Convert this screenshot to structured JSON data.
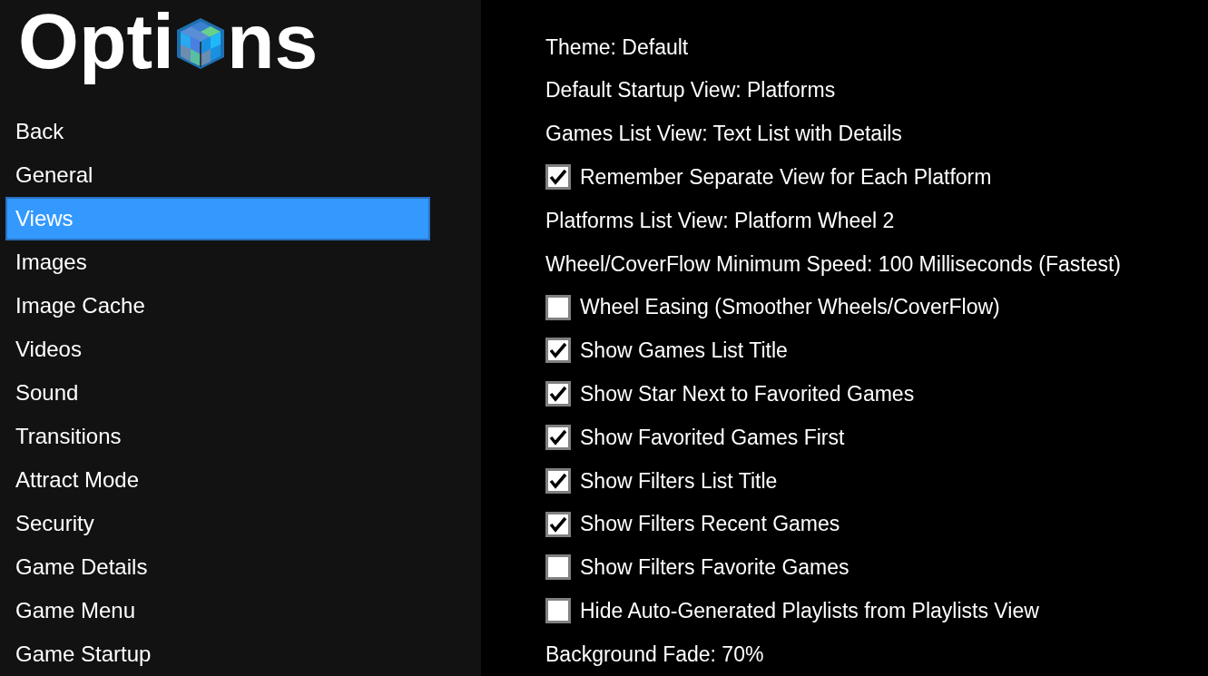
{
  "title": {
    "before": "Opti",
    "after": "ns"
  },
  "sidebar": {
    "items": [
      {
        "label": "Back",
        "selected": false
      },
      {
        "label": "General",
        "selected": false
      },
      {
        "label": "Views",
        "selected": true
      },
      {
        "label": "Images",
        "selected": false
      },
      {
        "label": "Image Cache",
        "selected": false
      },
      {
        "label": "Videos",
        "selected": false
      },
      {
        "label": "Sound",
        "selected": false
      },
      {
        "label": "Transitions",
        "selected": false
      },
      {
        "label": "Attract Mode",
        "selected": false
      },
      {
        "label": "Security",
        "selected": false
      },
      {
        "label": "Game Details",
        "selected": false
      },
      {
        "label": "Game Menu",
        "selected": false
      },
      {
        "label": "Game Startup",
        "selected": false
      }
    ]
  },
  "settings": [
    {
      "kind": "text",
      "label": "Theme: Default"
    },
    {
      "kind": "text",
      "label": "Default Startup View: Platforms"
    },
    {
      "kind": "text",
      "label": "Games List View: Text List with Details"
    },
    {
      "kind": "checkbox",
      "label": "Remember Separate View for Each Platform",
      "checked": true
    },
    {
      "kind": "text",
      "label": "Platforms List View: Platform Wheel 2"
    },
    {
      "kind": "text",
      "label": "Wheel/CoverFlow Minimum Speed: 100 Milliseconds (Fastest)"
    },
    {
      "kind": "checkbox",
      "label": "Wheel Easing (Smoother Wheels/CoverFlow)",
      "checked": false
    },
    {
      "kind": "checkbox",
      "label": "Show Games List Title",
      "checked": true
    },
    {
      "kind": "checkbox",
      "label": "Show Star Next to Favorited Games",
      "checked": true
    },
    {
      "kind": "checkbox",
      "label": "Show Favorited Games First",
      "checked": true
    },
    {
      "kind": "checkbox",
      "label": "Show Filters List Title",
      "checked": true
    },
    {
      "kind": "checkbox",
      "label": "Show Filters Recent Games",
      "checked": true
    },
    {
      "kind": "checkbox",
      "label": "Show Filters Favorite Games",
      "checked": false
    },
    {
      "kind": "checkbox",
      "label": "Hide Auto-Generated Playlists from Playlists View",
      "checked": false
    },
    {
      "kind": "text",
      "label": "Background Fade: 70%"
    }
  ]
}
